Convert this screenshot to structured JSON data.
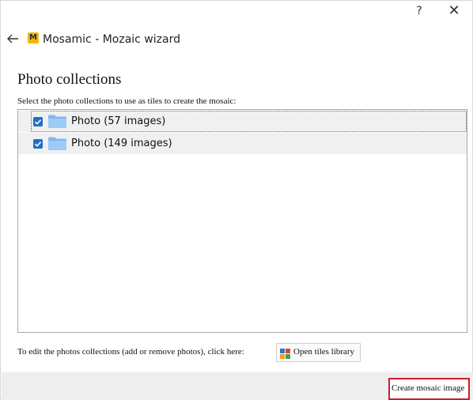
{
  "titlebar": {
    "help_label": "?",
    "close_label": "✕"
  },
  "app": {
    "icon_letter": "M",
    "title": "Mosamic - Mozaic wizard"
  },
  "page": {
    "heading": "Photo collections",
    "instruction": "Select the photo collections to use as tiles to create the mosaic:"
  },
  "collections": [
    {
      "label": "Photo (57 images)",
      "checked": true
    },
    {
      "label": "Photo (149 images)",
      "checked": true
    }
  ],
  "footer_text": "To edit the photos collections (add or remove photos), click here:",
  "buttons": {
    "open_library": "Open tiles library",
    "create": "Create mosaic image"
  },
  "colors": {
    "checkbox": "#1f6fc5",
    "highlight_border": "#c71f2c",
    "app_icon": "#f2b600"
  }
}
